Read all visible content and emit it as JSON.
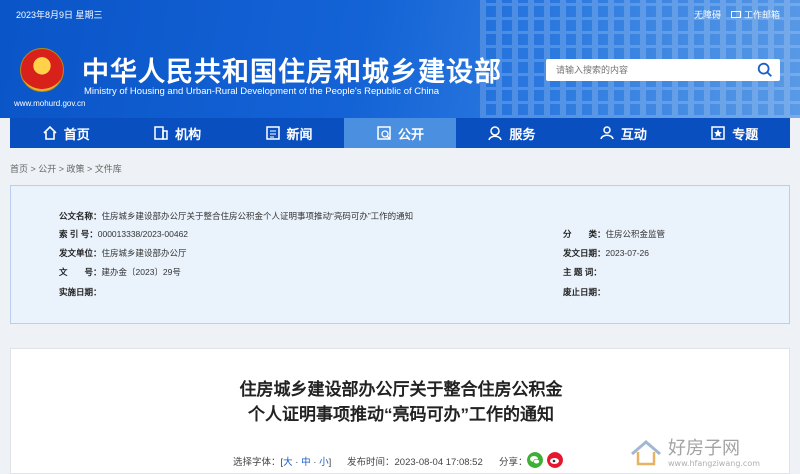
{
  "topbar": {
    "date": "2023年8月9日 星期三",
    "accessibility": "无障碍",
    "mail": "工作邮箱"
  },
  "header": {
    "title": "中华人民共和国住房和城乡建设部",
    "subtitle": "Ministry of Housing and Urban-Rural Development of the People's Republic of China",
    "url": "www.mohurd.gov.cn"
  },
  "search": {
    "placeholder": "请输入搜索的内容"
  },
  "nav": [
    {
      "label": "首页",
      "icon": "home-icon"
    },
    {
      "label": "机构",
      "icon": "building-icon"
    },
    {
      "label": "新闻",
      "icon": "news-icon"
    },
    {
      "label": "公开",
      "icon": "public-icon"
    },
    {
      "label": "服务",
      "icon": "service-icon"
    },
    {
      "label": "互动",
      "icon": "interact-icon"
    },
    {
      "label": "专题",
      "icon": "topic-icon"
    }
  ],
  "active_nav": "公开",
  "breadcrumb": "首页 > 公开 > 政策 > 文件库",
  "info": {
    "title_label": "公文名称：",
    "title_value": "住房城乡建设部办公厅关于整合住房公积金个人证明事项推动“亮码可办”工作的通知",
    "index_label": "索 引 号：",
    "index_value": "000013338/2023-00462",
    "category_label": "分　　类：",
    "category_value": "住房公积金监管",
    "issuer_label": "发文单位：",
    "issuer_value": "住房城乡建设部办公厅",
    "date_label": "发文日期：",
    "date_value": "2023-07-26",
    "number_label": "文　　号：",
    "number_value": "建办金〔2023〕29号",
    "subject_label": "主 题 词：",
    "subject_value": "",
    "effective_label": "实施日期：",
    "effective_value": "",
    "expire_label": "废止日期：",
    "expire_value": ""
  },
  "article": {
    "title_line1": "住房城乡建设部办公厅关于整合住房公积金",
    "title_line2": "个人证明事项推动“亮码可办”工作的通知",
    "font_label": "选择字体：[",
    "font_large": "大",
    "font_medium": "中",
    "font_small": "小",
    "font_close": "]",
    "publish_label": "发布时间：",
    "publish_time": "2023-08-04 17:08:52",
    "share_label": "分享："
  },
  "watermark": {
    "text": "好房子网",
    "url": "www.hfangziwang.com"
  }
}
